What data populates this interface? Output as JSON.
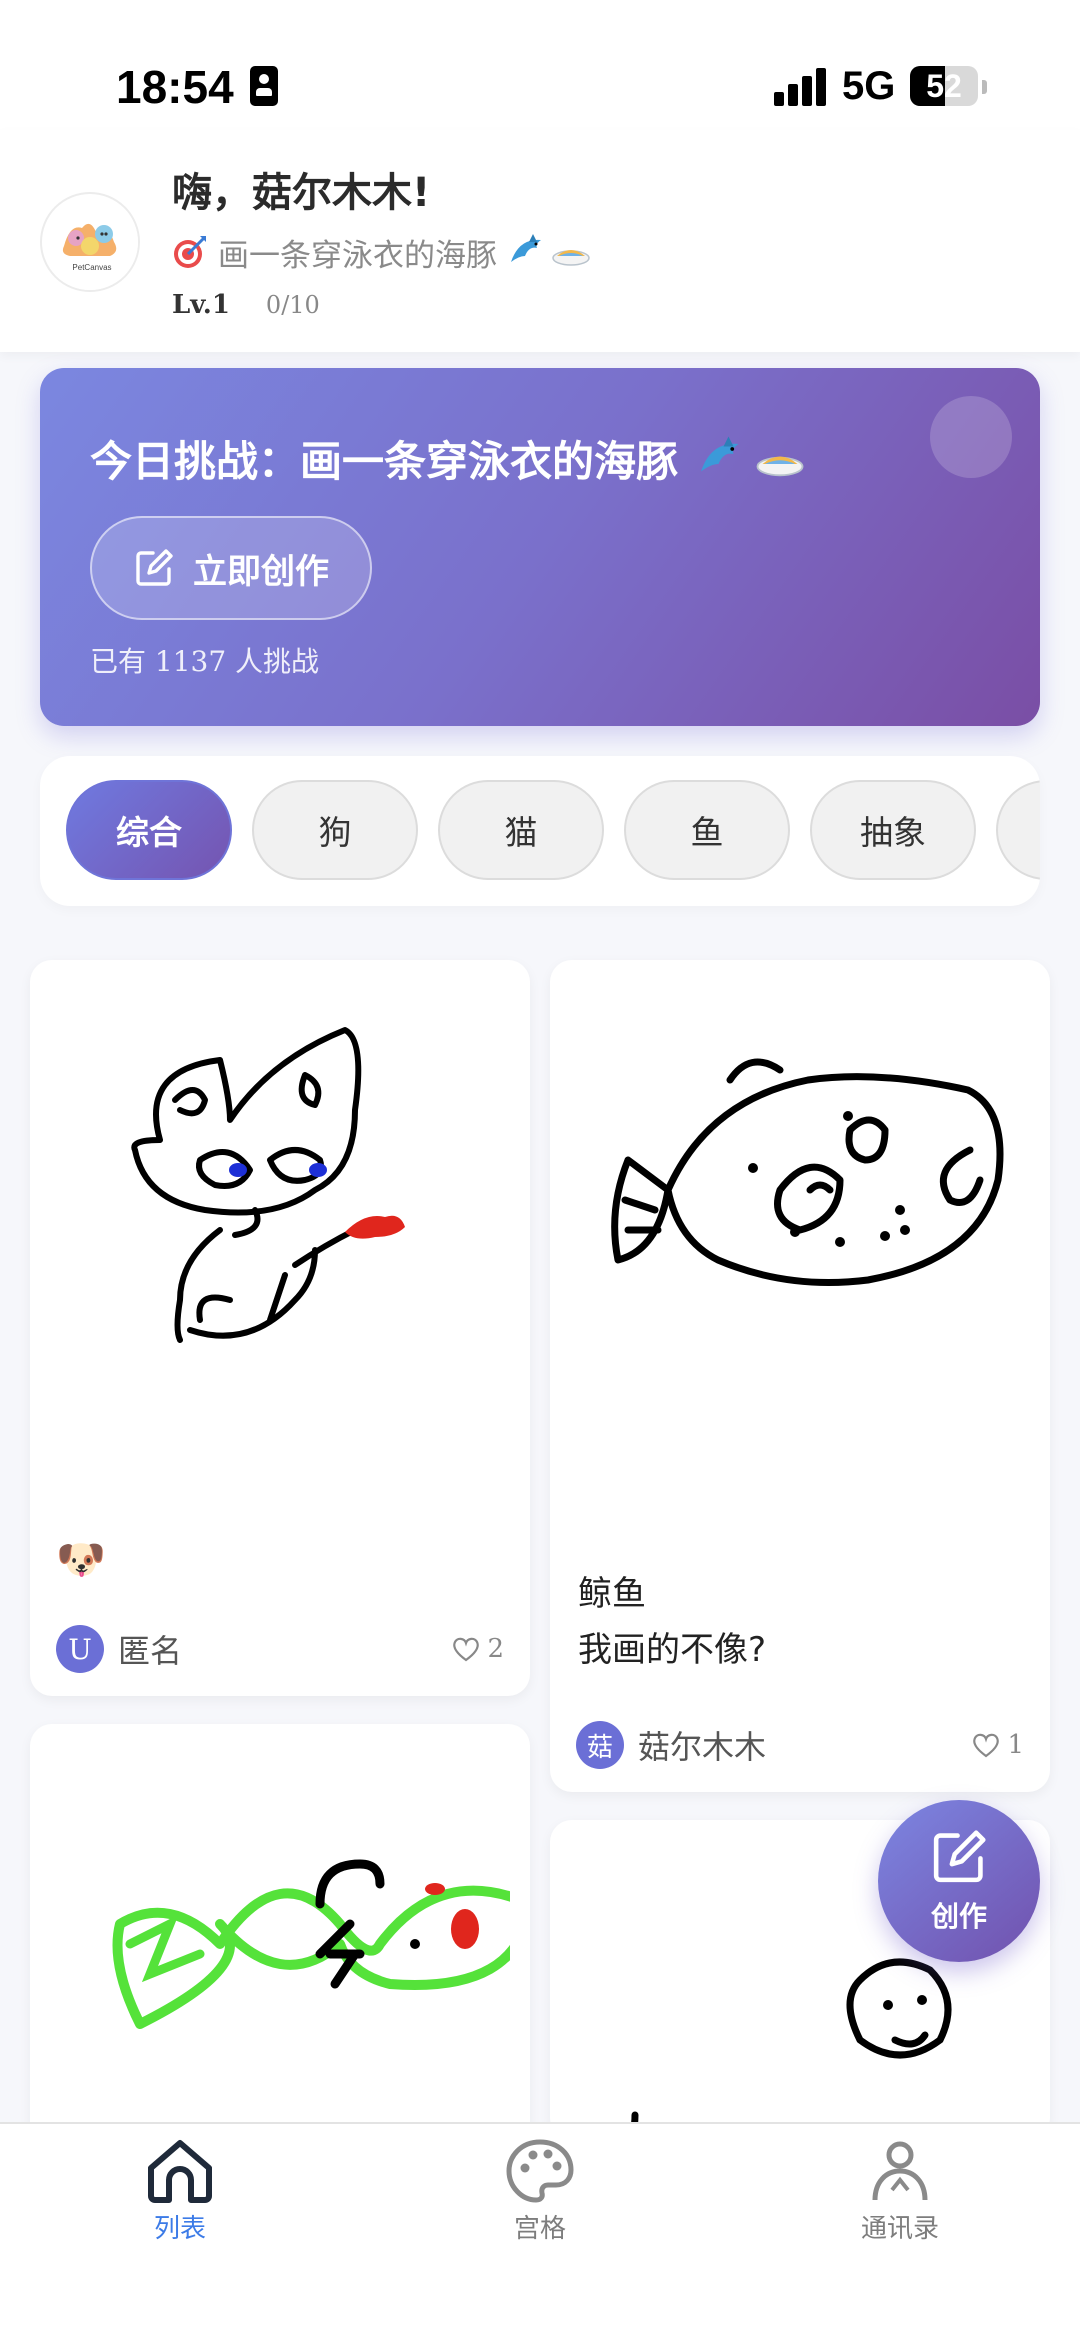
{
  "status_bar": {
    "time": "18:54",
    "network": "5G",
    "battery_percent": 52,
    "battery_label": "52"
  },
  "header": {
    "greeting": "嗨，菇尔木木!",
    "goal_text": "画一条穿泳衣的海豚",
    "level": "Lv.1",
    "progress": "0/10",
    "avatar_icon": "petcanvas-logo"
  },
  "banner": {
    "title": "今日挑战：画一条穿泳衣的海豚",
    "create_label": "立即创作",
    "participants": "已有 1137 人挑战"
  },
  "categories": [
    "综合",
    "狗",
    "猫",
    "鱼",
    "抽象"
  ],
  "active_category": "综合",
  "feed": [
    {
      "emoji": "🐶",
      "title": "",
      "author_badge": "U",
      "author": "匿名",
      "likes": "2"
    },
    {
      "emoji": "",
      "title_line1": "鲸鱼",
      "title_line2": "我画的不像?",
      "author_badge": "菇",
      "author": "菇尔木木",
      "likes": "1"
    }
  ],
  "fab": {
    "label": "创作"
  },
  "tabs": [
    {
      "label": "列表",
      "icon": "home-icon",
      "active": true
    },
    {
      "label": "宫格",
      "icon": "palette-icon",
      "active": false
    },
    {
      "label": "通讯录",
      "icon": "person-icon",
      "active": false
    }
  ],
  "colors": {
    "accent": "#3c7be7",
    "banner_start": "#7b87e0",
    "banner_end": "#7a4ea5"
  }
}
